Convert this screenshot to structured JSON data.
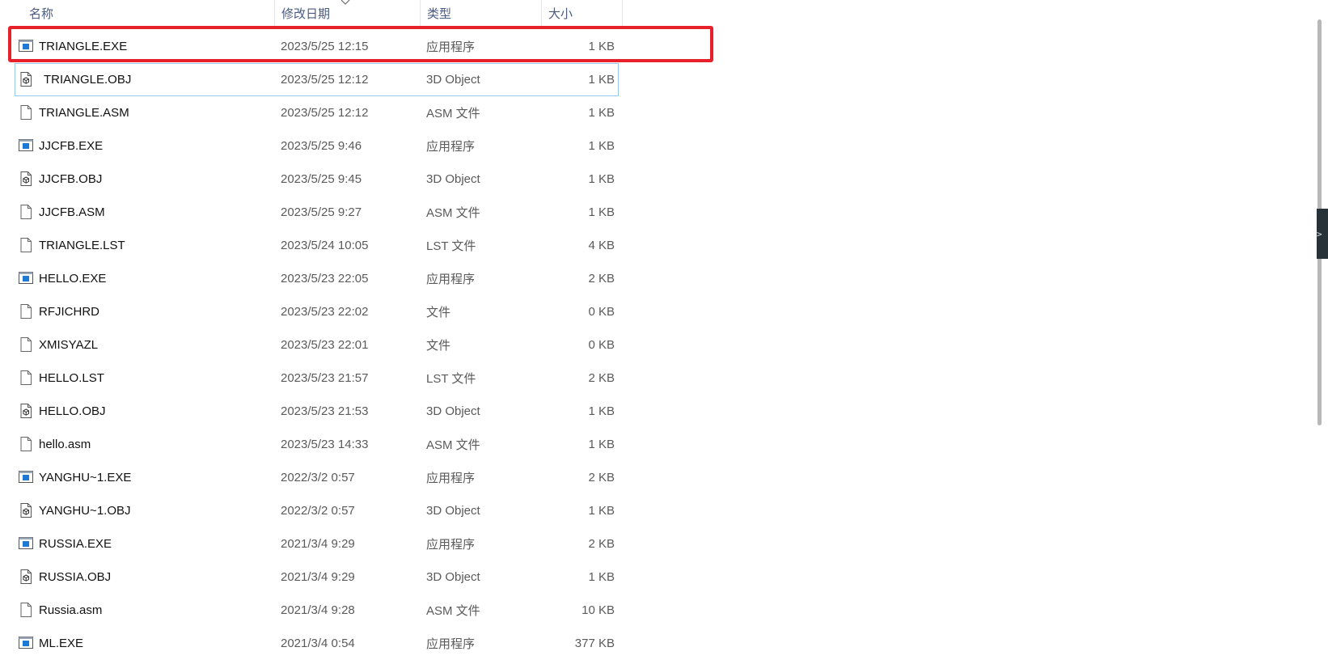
{
  "columns": {
    "name": "名称",
    "date": "修改日期",
    "type": "类型",
    "size": "大小"
  },
  "files": [
    {
      "name": "TRIANGLE.EXE",
      "date": "2023/5/25 12:15",
      "type": "应用程序",
      "size": "1 KB",
      "icon": "exe-icon"
    },
    {
      "name": "TRIANGLE.OBJ",
      "date": "2023/5/25 12:12",
      "type": "3D Object",
      "size": "1 KB",
      "icon": "obj-icon"
    },
    {
      "name": "TRIANGLE.ASM",
      "date": "2023/5/25 12:12",
      "type": "ASM 文件",
      "size": "1 KB",
      "icon": "file-icon"
    },
    {
      "name": "JJCFB.EXE",
      "date": "2023/5/25 9:46",
      "type": "应用程序",
      "size": "1 KB",
      "icon": "exe-icon"
    },
    {
      "name": "JJCFB.OBJ",
      "date": "2023/5/25 9:45",
      "type": "3D Object",
      "size": "1 KB",
      "icon": "obj-icon"
    },
    {
      "name": "JJCFB.ASM",
      "date": "2023/5/25 9:27",
      "type": "ASM 文件",
      "size": "1 KB",
      "icon": "file-icon"
    },
    {
      "name": "TRIANGLE.LST",
      "date": "2023/5/24 10:05",
      "type": "LST 文件",
      "size": "4 KB",
      "icon": "file-icon"
    },
    {
      "name": "HELLO.EXE",
      "date": "2023/5/23 22:05",
      "type": "应用程序",
      "size": "2 KB",
      "icon": "exe-icon"
    },
    {
      "name": "RFJICHRD",
      "date": "2023/5/23 22:02",
      "type": "文件",
      "size": "0 KB",
      "icon": "file-icon"
    },
    {
      "name": "XMISYAZL",
      "date": "2023/5/23 22:01",
      "type": "文件",
      "size": "0 KB",
      "icon": "file-icon"
    },
    {
      "name": "HELLO.LST",
      "date": "2023/5/23 21:57",
      "type": "LST 文件",
      "size": "2 KB",
      "icon": "file-icon"
    },
    {
      "name": "HELLO.OBJ",
      "date": "2023/5/23 21:53",
      "type": "3D Object",
      "size": "1 KB",
      "icon": "obj-icon"
    },
    {
      "name": "hello.asm",
      "date": "2023/5/23 14:33",
      "type": "ASM 文件",
      "size": "1 KB",
      "icon": "file-icon"
    },
    {
      "name": "YANGHU~1.EXE",
      "date": "2022/3/2 0:57",
      "type": "应用程序",
      "size": "2 KB",
      "icon": "exe-icon"
    },
    {
      "name": "YANGHU~1.OBJ",
      "date": "2022/3/2 0:57",
      "type": "3D Object",
      "size": "1 KB",
      "icon": "obj-icon"
    },
    {
      "name": "RUSSIA.EXE",
      "date": "2021/3/4 9:29",
      "type": "应用程序",
      "size": "2 KB",
      "icon": "exe-icon"
    },
    {
      "name": "RUSSIA.OBJ",
      "date": "2021/3/4 9:29",
      "type": "3D Object",
      "size": "1 KB",
      "icon": "obj-icon"
    },
    {
      "name": "Russia.asm",
      "date": "2021/3/4 9:28",
      "type": "ASM 文件",
      "size": "10 KB",
      "icon": "file-icon"
    },
    {
      "name": "ML.EXE",
      "date": "2021/3/4 0:54",
      "type": "应用程序",
      "size": "377 KB",
      "icon": "exe-icon"
    }
  ],
  "side_tab_label": ">",
  "colors": {
    "highlight": "#e8202a",
    "focus_outline": "#99c9ef",
    "header_text": "#4a5a80",
    "exe_blue": "#1e78d6"
  }
}
